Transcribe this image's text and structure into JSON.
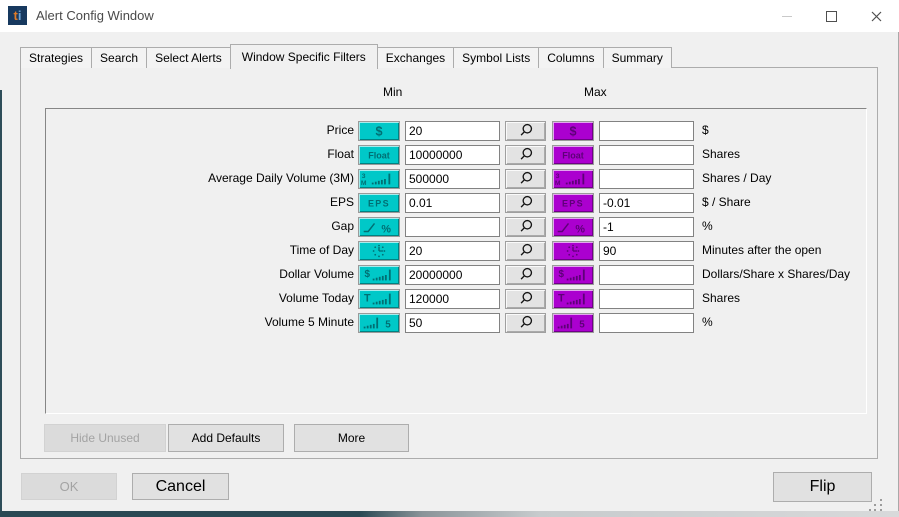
{
  "titlebar": {
    "title": "Alert Config Window",
    "logo_t": "t",
    "logo_i": "i"
  },
  "tabs": [
    {
      "label": "Strategies",
      "active": false
    },
    {
      "label": "Search",
      "active": false
    },
    {
      "label": "Select Alerts",
      "active": false
    },
    {
      "label": "Window Specific Filters",
      "active": true
    },
    {
      "label": "Exchanges",
      "active": false
    },
    {
      "label": "Symbol Lists",
      "active": false
    },
    {
      "label": "Columns",
      "active": false
    },
    {
      "label": "Summary",
      "active": false
    }
  ],
  "table": {
    "min_header": "Min",
    "max_header": "Max",
    "rows": [
      {
        "label": "Price",
        "icon": "dollar",
        "min": "20",
        "max": "",
        "unit": "$"
      },
      {
        "label": "Float",
        "icon": "float",
        "min": "10000000",
        "max": "",
        "unit": "Shares"
      },
      {
        "label": "Average Daily Volume (3M)",
        "icon": "adv-3m",
        "min": "500000",
        "max": "",
        "unit": "Shares / Day"
      },
      {
        "label": "EPS",
        "icon": "eps",
        "min": "0.01",
        "max": "-0.01",
        "unit": "$ / Share"
      },
      {
        "label": "Gap",
        "icon": "gap-percent",
        "min": "",
        "max": "-1",
        "unit": "%"
      },
      {
        "label": "Time of Day",
        "icon": "clock",
        "min": "20",
        "max": "90",
        "unit": "Minutes after the open"
      },
      {
        "label": "Dollar Volume",
        "icon": "dollar-volume",
        "min": "20000000",
        "max": "",
        "unit": "Dollars/Share x Shares/Day"
      },
      {
        "label": "Volume Today",
        "icon": "volume-today",
        "min": "120000",
        "max": "",
        "unit": "Shares"
      },
      {
        "label": "Volume 5 Minute",
        "icon": "volume-5min",
        "min": "50",
        "max": "",
        "unit": "%"
      }
    ]
  },
  "panel_buttons": {
    "hide_unused": {
      "label": "Hide Unused",
      "disabled": true
    },
    "add_defaults": {
      "label": "Add Defaults",
      "disabled": false
    },
    "more": {
      "label": "More",
      "disabled": false
    }
  },
  "footer_buttons": {
    "ok": {
      "label": "OK",
      "disabled": true
    },
    "cancel": {
      "label": "Cancel",
      "disabled": false
    },
    "flip": {
      "label": "Flip",
      "disabled": false
    }
  },
  "colors": {
    "min_accent": "#00C8C8",
    "min_glyph": "#006F73",
    "max_accent": "#AB00CF",
    "max_glyph": "#5E0078"
  }
}
